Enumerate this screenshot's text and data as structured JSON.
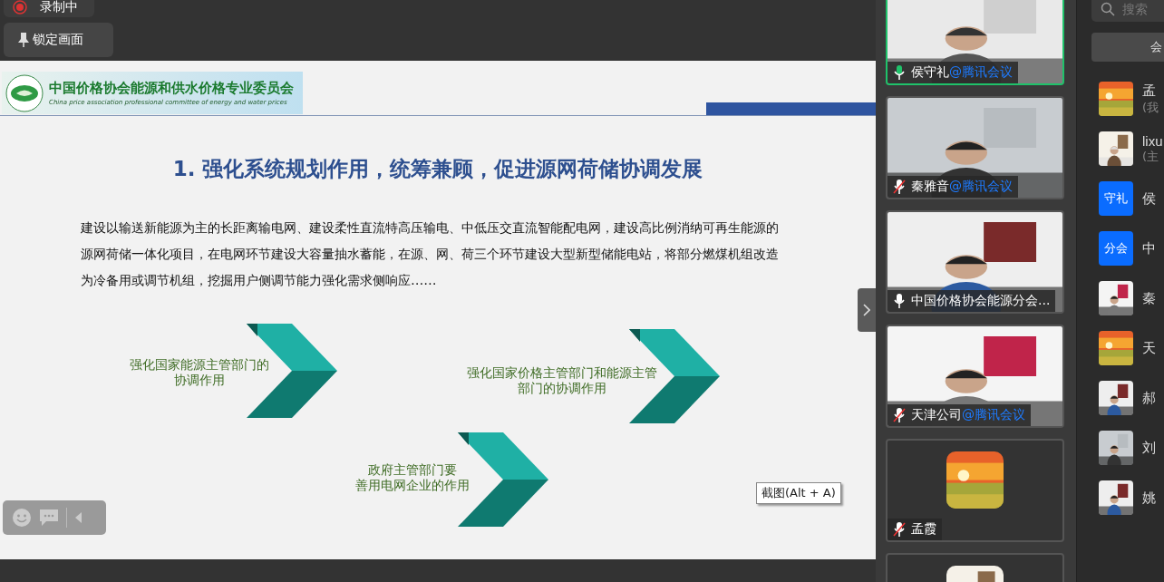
{
  "recording": {
    "label": "录制中",
    "on": true
  },
  "lock_button": {
    "label": "锁定画面"
  },
  "slide": {
    "org_name": "中国价格协会能源和供水价格专业委员会",
    "org_name_en": "China price association professional committee of energy and water prices",
    "title": "1. 强化系统规划作用，统筹兼顾，促进源网荷储协调发展",
    "body": "建设以输送新能源为主的长距离输电网、建设柔性直流特高压输电、中低压交直流智能配电网，建设高比例消纳可再生能源的源网荷储一体化项目，在电网环节建设大容量抽水蓄能，在源、网、荷三个环节建设大型新型储能电站，将部分燃煤机组改造为冷备用或调节机组，挖掘用户侧调节能力强化需求侧响应……",
    "items": [
      {
        "lines": [
          "强化国家能源主管部门的",
          "协调作用"
        ]
      },
      {
        "lines": [
          "强化国家价格主管部门和能源主管",
          "部门的协调作用"
        ]
      },
      {
        "lines": [
          "政府主管部门要",
          "善用电网企业的作用"
        ]
      }
    ]
  },
  "tooltip": "截图(Alt + A)",
  "videos": [
    {
      "kind": "video",
      "name": "侯守礼",
      "suffix": "@腾讯会议",
      "muted": false,
      "speaking": true,
      "active": true
    },
    {
      "kind": "video",
      "name": "秦雅音",
      "suffix": "@腾讯会议",
      "muted": true,
      "speaking": false,
      "active": false
    },
    {
      "kind": "video",
      "name": "中国价格协会能源分会...",
      "muted": false,
      "speaking": false,
      "active": false
    },
    {
      "kind": "video",
      "name": "天津公司",
      "suffix": "@腾讯会议",
      "muted": true,
      "speaking": false,
      "active": false
    },
    {
      "kind": "avatar",
      "name": "孟霞",
      "muted": true,
      "speaking": false,
      "active": false
    },
    {
      "kind": "avatar",
      "active": false
    }
  ],
  "members": {
    "search": {
      "placeholder": "搜索"
    },
    "tab": "会",
    "participants": [
      {
        "kind": "picture",
        "name": "孟",
        "note": "(我"
      },
      {
        "kind": "picture",
        "name": "lixu",
        "note": "(主"
      },
      {
        "kind": "initials",
        "avatar_text": "守礼",
        "name": "侯"
      },
      {
        "kind": "initials",
        "avatar_text": "分会",
        "name": "中"
      },
      {
        "kind": "picture",
        "name": "秦"
      },
      {
        "kind": "picture",
        "name": "天"
      },
      {
        "kind": "picture",
        "name": "郝"
      },
      {
        "kind": "picture",
        "name": "刘"
      },
      {
        "kind": "picture",
        "name": "姚"
      }
    ]
  }
}
